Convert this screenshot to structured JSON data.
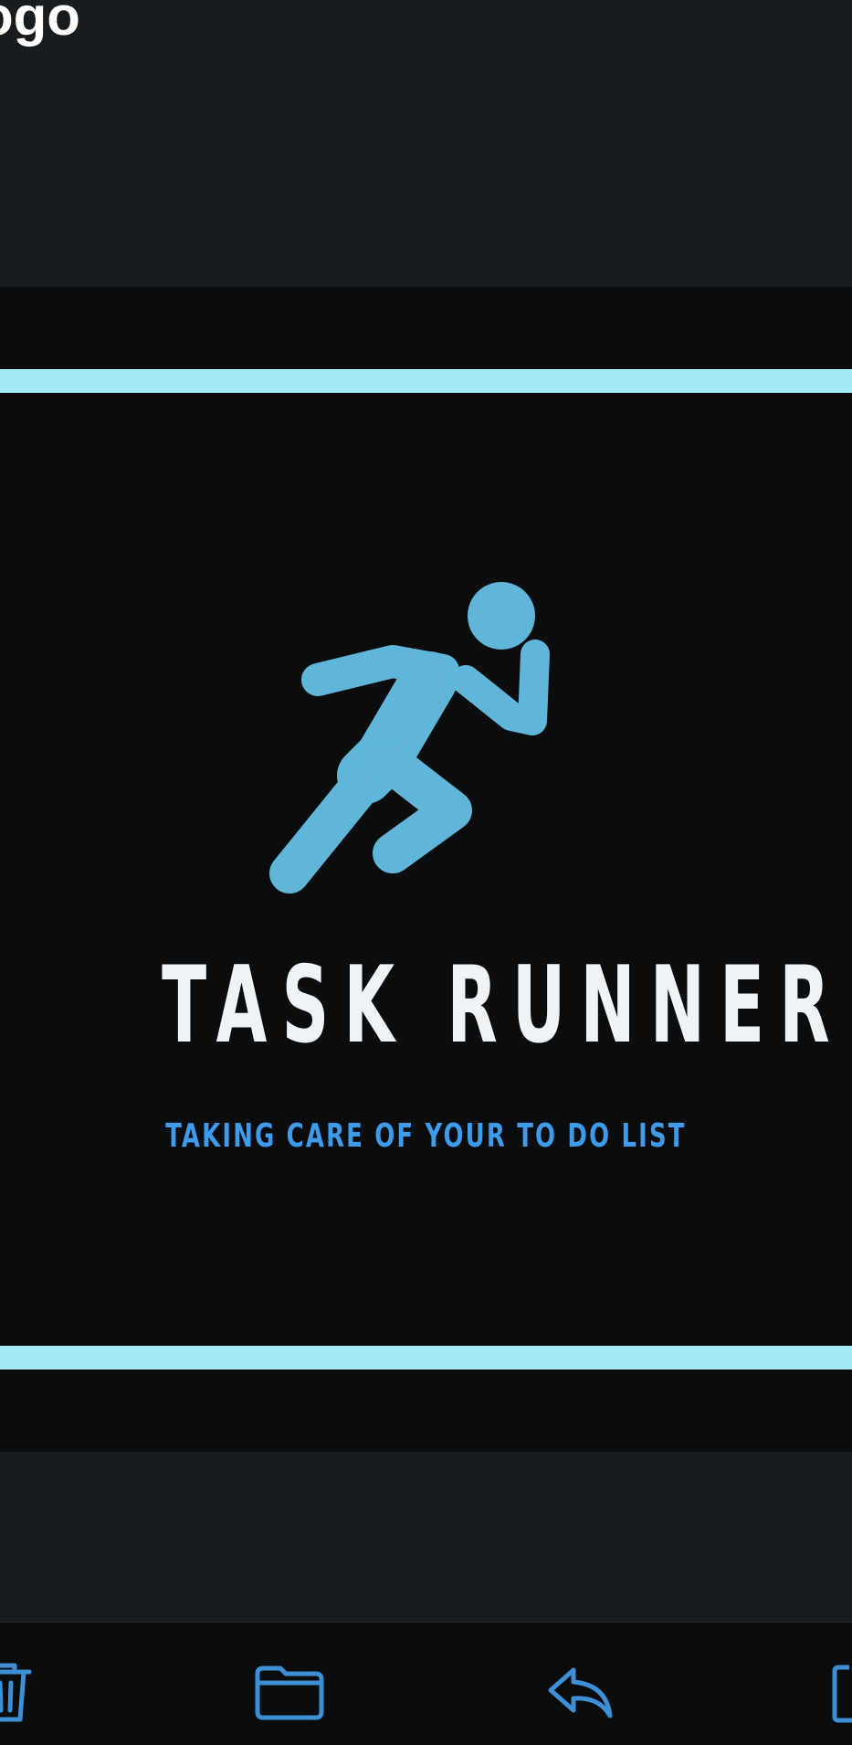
{
  "header": {
    "title": "ogo"
  },
  "attachment": {
    "logo_title": "TASK RUNNER",
    "logo_tagline": "TAKING CARE OF YOUR TO DO LIST",
    "icon": "running-person-icon"
  },
  "toolbar": {
    "buttons": [
      {
        "icon": "trash-icon"
      },
      {
        "icon": "folder-icon"
      },
      {
        "icon": "reply-icon"
      },
      {
        "icon": "compose-icon"
      }
    ]
  },
  "colors": {
    "background": "#181c1f",
    "image_background": "#0a0c0e",
    "stripe": "#a3e9f7",
    "runner": "#5fb6d8",
    "title_text": "#eef3f5",
    "tagline_text": "#3d9bea",
    "toolbar_icon": "#3d8fd6"
  }
}
